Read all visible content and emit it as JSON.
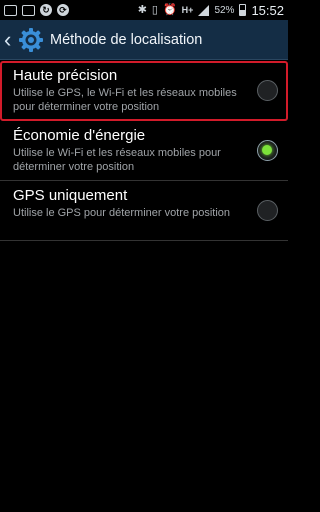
{
  "status_bar": {
    "battery_percent": "52%",
    "time": "15:52",
    "left_icons": [
      "mail-icon",
      "image-icon",
      "sync-icon",
      "app-icon"
    ],
    "right_icons": [
      "bluetooth-icon",
      "vibrate-icon",
      "alarm-icon",
      "hplus-icon",
      "signal-icon",
      "battery-icon"
    ]
  },
  "action_bar": {
    "title": "Méthode de localisation",
    "icon": "settings-gear-icon",
    "background": "#142d45"
  },
  "options": [
    {
      "title": "Haute précision",
      "description": "Utilise le GPS, le Wi-Fi et les réseaux mobiles pour déterminer votre position",
      "selected": false,
      "highlighted": true
    },
    {
      "title": "Économie d'énergie",
      "description": "Utilise le Wi-Fi et les réseaux mobiles pour déterminer votre position",
      "selected": true,
      "highlighted": false
    },
    {
      "title": "GPS uniquement",
      "description": "Utilise le GPS pour déterminer votre position",
      "selected": false,
      "highlighted": false
    }
  ],
  "colors": {
    "highlight_border": "#d21b2a",
    "radio_selected": "#7ce23a"
  }
}
